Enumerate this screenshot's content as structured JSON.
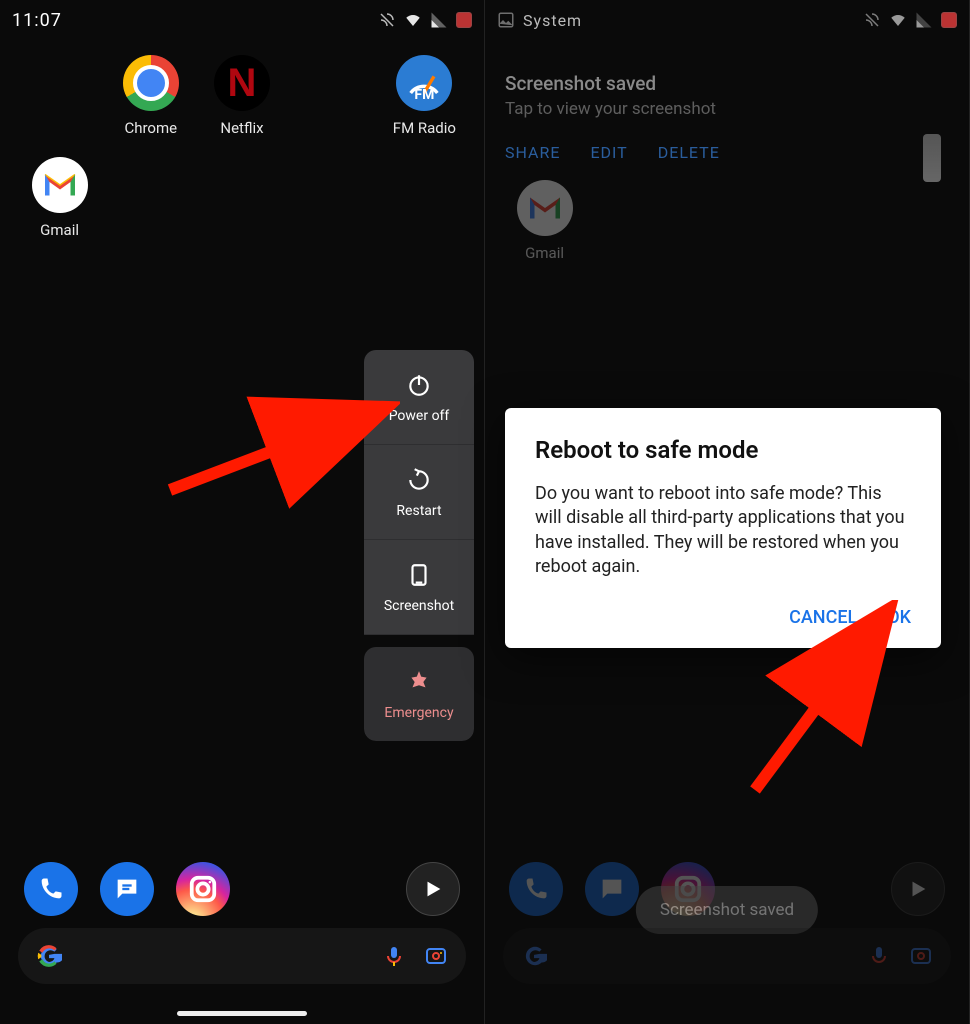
{
  "left": {
    "status": {
      "time": "11:07"
    },
    "apps": {
      "chrome": "Chrome",
      "netflix": "Netflix",
      "netflix_letter": "N",
      "fmradio": "FM Radio",
      "fm_short": "FM",
      "gmail": "Gmail"
    },
    "power_menu": {
      "power_off": "Power off",
      "restart": "Restart",
      "screenshot": "Screenshot",
      "emergency": "Emergency"
    }
  },
  "right": {
    "status": {
      "source": "System"
    },
    "notification": {
      "title": "Screenshot saved",
      "subtitle": "Tap to view your screenshot",
      "actions": {
        "share": "SHARE",
        "edit": "EDIT",
        "delete": "DELETE"
      }
    },
    "apps": {
      "gmail": "Gmail"
    },
    "dialog": {
      "title": "Reboot to safe mode",
      "body": "Do you want to reboot into safe mode? This will disable all third-party applications that you have installed. They will be restored when you reboot again.",
      "cancel": "CANCEL",
      "ok": "OK"
    },
    "toast": "Screenshot saved"
  }
}
